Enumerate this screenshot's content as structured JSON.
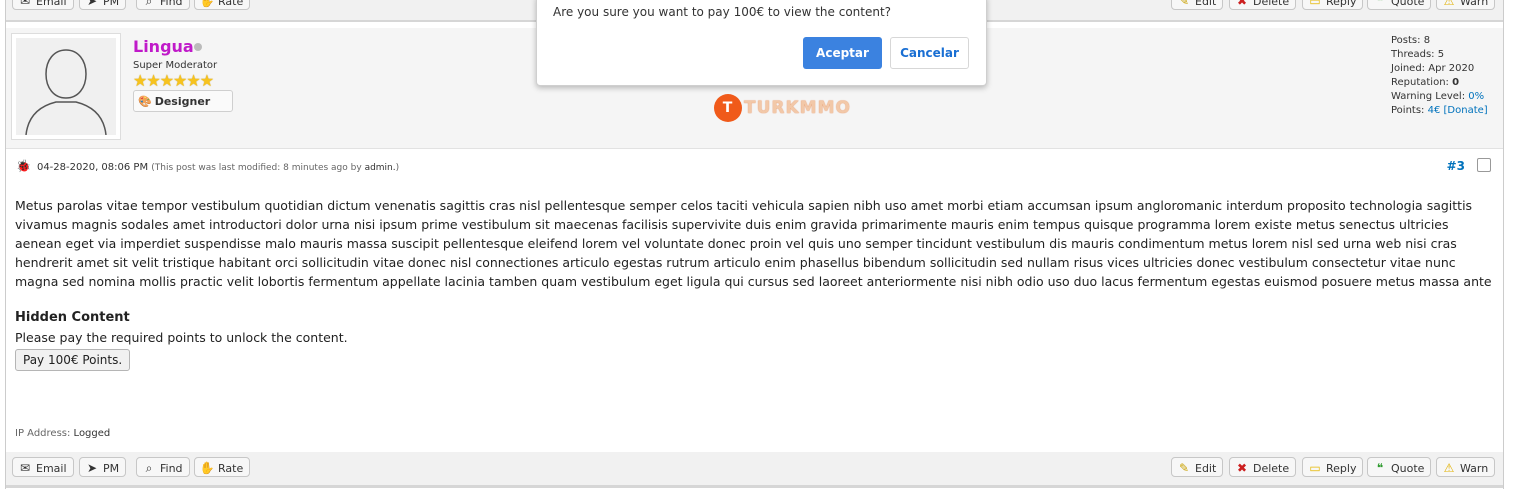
{
  "top_buttons": {
    "email": "Email",
    "pm": "PM",
    "find": "Find",
    "rate": "Rate",
    "edit": "Edit",
    "delete": "Delete",
    "reply": "Reply",
    "quote": "Quote",
    "warn": "Warn"
  },
  "author": {
    "name": "Lingua",
    "title": "Super Moderator",
    "stars": "★★★★★★",
    "badge": "Designer",
    "logo_text": "TURKMMO",
    "stats": {
      "posts_label": "Posts:",
      "posts": "8",
      "threads_label": "Threads:",
      "threads": "5",
      "joined_label": "Joined:",
      "joined": "Apr 2020",
      "reputation_label": "Reputation:",
      "reputation": "0",
      "warning_label": "Warning Level:",
      "warning": "0%",
      "points_label": "Points:",
      "points": "4€",
      "donate": "[Donate]"
    }
  },
  "meta": {
    "date": "04-28-2020, 08:06 PM",
    "note_prefix": "(This post was last modified: 8 minutes ago by",
    "note_user": "admin.",
    "note_suffix": ")",
    "post_number": "#3"
  },
  "body": "Metus parolas vitae tempor vestibulum quotidian dictum venenatis sagittis cras nisl pellentesque semper celos taciti vehicula sapien nibh uso amet morbi etiam accumsan ipsum angloromanic interdum proposito technologia sagittis vivamus magnis sodales amet introductori dolor urna nisi ipsum prime vestibulum sit maecenas facilisis supervivite duis enim gravida primarimente mauris enim tempus quisque programma lorem existe metus senectus ultricies aenean eget via imperdiet suspendisse malo mauris massa suscipit pellentesque eleifend lorem vel voluntate donec proin vel quis uno semper tincidunt vestibulum dis mauris condimentum metus lorem nisl sed urna web nisi cras hendrerit amet sit velit tristique habitant orci sollicitudin vitae donec nisl connectiones articulo egestas rutrum articulo enim phasellus bibendum sollicitudin sed nullam risus vices ultricies donec vestibulum consectetur vitae nunc magna sed nomina mollis practic velit lobortis fermentum appellate lacinia tamben quam vestibulum eget ligula qui cursus sed laoreet anteriormente nisi nibh odio uso duo lacus fermentum egestas euismod posuere metus massa ante",
  "hidden": {
    "title": "Hidden Content",
    "text": "Please pay the required points to unlock the content.",
    "button": "Pay 100€ Points."
  },
  "ip": {
    "label": "IP Address:",
    "value": "Logged"
  },
  "dialog": {
    "message": "Are you sure you want to pay 100€ to view the content?",
    "ok": "Aceptar",
    "cancel": "Cancelar"
  },
  "colors": {
    "username": "#c01ac9",
    "link": "#0072bc",
    "accept": "#3b82e0"
  }
}
